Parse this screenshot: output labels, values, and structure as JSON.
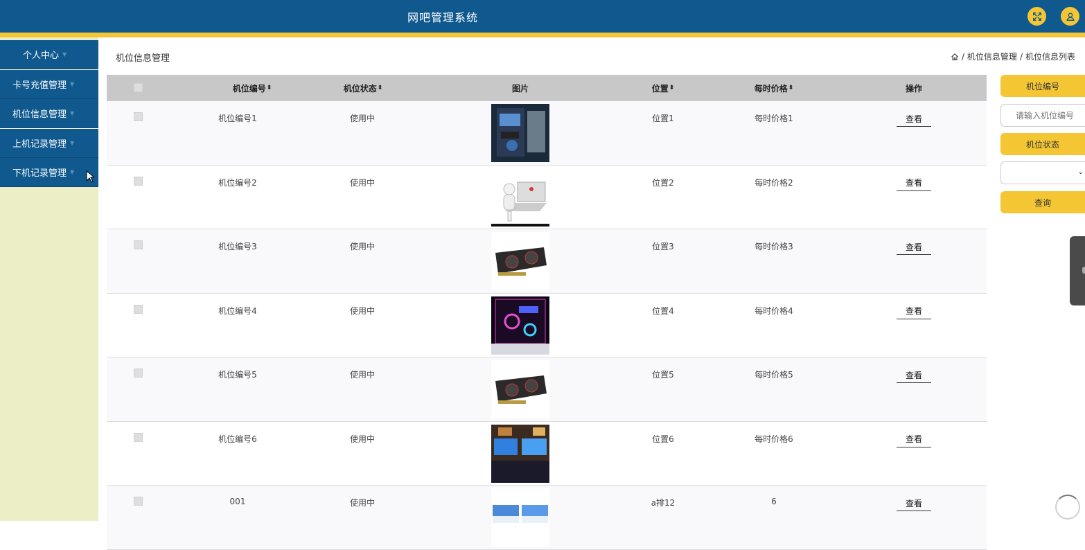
{
  "app": {
    "title": "网吧管理系统"
  },
  "header": {
    "fullscreen_icon": "fullscreen-icon",
    "user_icon": "user-icon",
    "accent": "#f5c634",
    "bar_color": "#10598f"
  },
  "sidebar": {
    "items": [
      {
        "label": "个人中心"
      },
      {
        "label": "卡号充值管理"
      },
      {
        "label": "机位信息管理"
      },
      {
        "label": "上机记录管理"
      },
      {
        "label": "下机记录管理"
      }
    ],
    "bg": "#ecefc6"
  },
  "page": {
    "title": "机位信息管理",
    "breadcrumb": {
      "home_icon": "home-icon",
      "separator": "/",
      "level1": "机位信息管理",
      "level2": "机位信息列表"
    }
  },
  "table": {
    "columns": [
      "机位编号",
      "机位状态",
      "图片",
      "位置",
      "每时价格",
      "操作"
    ],
    "sortable": [
      true,
      true,
      false,
      true,
      true,
      false
    ],
    "sort_glyph": "⬍",
    "action_label": "查看",
    "rows": [
      {
        "code": "机位编号1",
        "status": "使用中",
        "image": "pc-case-thumb",
        "location": "位置1",
        "price": "每时价格1"
      },
      {
        "code": "机位编号2",
        "status": "使用中",
        "image": "figure-laptop-thumb",
        "location": "位置2",
        "price": "每时价格2"
      },
      {
        "code": "机位编号3",
        "status": "使用中",
        "image": "graphics-card-thumb",
        "location": "位置3",
        "price": "每时价格3"
      },
      {
        "code": "机位编号4",
        "status": "使用中",
        "image": "rgb-case-thumb",
        "location": "位置4",
        "price": "每时价格4"
      },
      {
        "code": "机位编号5",
        "status": "使用中",
        "image": "graphics-card-thumb",
        "location": "位置5",
        "price": "每时价格5"
      },
      {
        "code": "机位编号6",
        "status": "使用中",
        "image": "gaming-room-thumb",
        "location": "位置6",
        "price": "每时价格6"
      },
      {
        "code": "001",
        "status": "使用中",
        "image": "monitors-thumb",
        "location": "a排12",
        "price": "6"
      }
    ]
  },
  "search": {
    "code_label": "机位编号",
    "code_placeholder": "请输入机位编号",
    "status_label": "机位状态",
    "status_value": "",
    "query_label": "查询"
  }
}
